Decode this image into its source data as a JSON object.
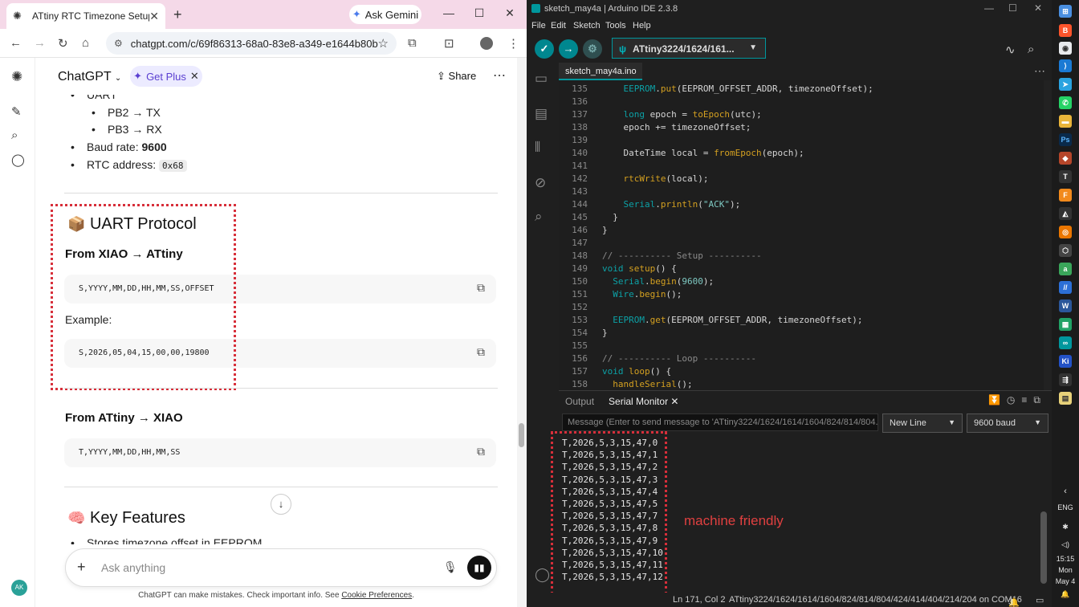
{
  "chrome": {
    "tab_title": "ATtiny RTC Timezone Setup",
    "gemini_label": "Ask Gemini",
    "url": "chatgpt.com/c/69f86313-68a0-83e8-a349-e1644b80b..."
  },
  "chatgpt": {
    "app_name": "ChatGPT",
    "get_plus": "Get Plus",
    "share": "Share",
    "avatar": "AK",
    "uart_label": "UART",
    "pb2": "PB2 → TX",
    "pb3": "PB3 → RX",
    "baud_label": "Baud rate: ",
    "baud_value": "9600",
    "rtc_label": "RTC address: ",
    "rtc_value": "0x68",
    "uart_heading": "UART Protocol",
    "uart_emoji": "📦",
    "from_xiao": "From XIAO → ATtiny",
    "code1": "S,YYYY,MM,DD,HH,MM,SS,OFFSET",
    "example_label": "Example:",
    "code2": "S,2026,05,04,15,00,00,19800",
    "from_attiny": "From ATtiny → XIAO",
    "code3": "T,YYYY,MM,DD,HH,MM,SS",
    "features_emoji": "🧠",
    "features_heading": "Key Features",
    "feature1": "Stores timezone offset in EEPROM",
    "input_placeholder": "Ask anything",
    "footer_text": "ChatGPT can make mistakes. Check important info. See ",
    "footer_link": "Cookie Preferences",
    "footer_end": "."
  },
  "ide": {
    "window_title": "sketch_may4a | Arduino IDE 2.3.8",
    "menu": [
      "File",
      "Edit",
      "Sketch",
      "Tools",
      "Help"
    ],
    "board": "ATtiny3224/1624/161...",
    "file_tab": "sketch_may4a.ino",
    "code_lines": [
      {
        "n": "135",
        "segs": [
          [
            "tx",
            "    "
          ],
          [
            "kw",
            "EEPROM"
          ],
          [
            "tx",
            "."
          ],
          [
            "fn",
            "put"
          ],
          [
            "tx",
            "(EEPROM_OFFSET_ADDR, timezoneOffset);"
          ]
        ]
      },
      {
        "n": "136",
        "segs": []
      },
      {
        "n": "137",
        "segs": [
          [
            "tx",
            "    "
          ],
          [
            "kw",
            "long"
          ],
          [
            "tx",
            " epoch = "
          ],
          [
            "fn",
            "toEpoch"
          ],
          [
            "tx",
            "(utc);"
          ]
        ]
      },
      {
        "n": "138",
        "segs": [
          [
            "tx",
            "    epoch += timezoneOffset;"
          ]
        ]
      },
      {
        "n": "139",
        "segs": []
      },
      {
        "n": "140",
        "segs": [
          [
            "tx",
            "    DateTime local = "
          ],
          [
            "fn",
            "fromEpoch"
          ],
          [
            "tx",
            "(epoch);"
          ]
        ]
      },
      {
        "n": "141",
        "segs": []
      },
      {
        "n": "142",
        "segs": [
          [
            "tx",
            "    "
          ],
          [
            "fn",
            "rtcWrite"
          ],
          [
            "tx",
            "(local);"
          ]
        ]
      },
      {
        "n": "143",
        "segs": []
      },
      {
        "n": "144",
        "segs": [
          [
            "tx",
            "    "
          ],
          [
            "kw",
            "Serial"
          ],
          [
            "tx",
            "."
          ],
          [
            "fn",
            "println"
          ],
          [
            "tx",
            "("
          ],
          [
            "str",
            "\"ACK\""
          ],
          [
            "tx",
            ");"
          ]
        ]
      },
      {
        "n": "145",
        "segs": [
          [
            "tx",
            "  }"
          ]
        ]
      },
      {
        "n": "146",
        "segs": [
          [
            "tx",
            "}"
          ]
        ]
      },
      {
        "n": "147",
        "segs": []
      },
      {
        "n": "148",
        "segs": [
          [
            "cm",
            "// ---------- Setup ----------"
          ]
        ]
      },
      {
        "n": "149",
        "segs": [
          [
            "kw",
            "void"
          ],
          [
            "tx",
            " "
          ],
          [
            "fn",
            "setup"
          ],
          [
            "tx",
            "() {"
          ]
        ]
      },
      {
        "n": "150",
        "segs": [
          [
            "tx",
            "  "
          ],
          [
            "kw",
            "Serial"
          ],
          [
            "tx",
            "."
          ],
          [
            "fn",
            "begin"
          ],
          [
            "tx",
            "("
          ],
          [
            "num",
            "9600"
          ],
          [
            "tx",
            ");"
          ]
        ]
      },
      {
        "n": "151",
        "segs": [
          [
            "tx",
            "  "
          ],
          [
            "kw",
            "Wire"
          ],
          [
            "tx",
            "."
          ],
          [
            "fn",
            "begin"
          ],
          [
            "tx",
            "();"
          ]
        ]
      },
      {
        "n": "152",
        "segs": []
      },
      {
        "n": "153",
        "segs": [
          [
            "tx",
            "  "
          ],
          [
            "kw",
            "EEPROM"
          ],
          [
            "tx",
            "."
          ],
          [
            "fn",
            "get"
          ],
          [
            "tx",
            "(EEPROM_OFFSET_ADDR, timezoneOffset);"
          ]
        ]
      },
      {
        "n": "154",
        "segs": [
          [
            "tx",
            "}"
          ]
        ]
      },
      {
        "n": "155",
        "segs": []
      },
      {
        "n": "156",
        "segs": [
          [
            "cm",
            "// ---------- Loop ----------"
          ]
        ]
      },
      {
        "n": "157",
        "segs": [
          [
            "kw",
            "void"
          ],
          [
            "tx",
            " "
          ],
          [
            "fn",
            "loop"
          ],
          [
            "tx",
            "() {"
          ]
        ]
      },
      {
        "n": "158",
        "segs": [
          [
            "tx",
            "  "
          ],
          [
            "fn",
            "handleSerial"
          ],
          [
            "tx",
            "();"
          ]
        ]
      }
    ],
    "tab_output": "Output",
    "tab_serial": "Serial Monitor",
    "msg_placeholder": "Message (Enter to send message to 'ATtiny3224/1624/1614/1604/824/814/804...",
    "line_ending": "New Line",
    "baud": "9600 baud",
    "serial_lines": [
      "T,2026,5,3,15,47,0",
      "T,2026,5,3,15,47,1",
      "T,2026,5,3,15,47,2",
      "T,2026,5,3,15,47,3",
      "T,2026,5,3,15,47,4",
      "T,2026,5,3,15,47,5",
      "T,2026,5,3,15,47,7",
      "T,2026,5,3,15,47,8",
      "T,2026,5,3,15,47,9",
      "T,2026,5,3,15,47,10",
      "T,2026,5,3,15,47,11",
      "T,2026,5,3,15,47,12"
    ],
    "annotation": "machine friendly",
    "status_pos": "Ln 171, Col 2",
    "status_board": "ATtiny3224/1624/1614/1604/824/814/804/424/414/404/214/204 on COM16",
    "status_count": "3"
  },
  "taskbar": {
    "lang": "ENG",
    "time": "15:15",
    "day": "Mon",
    "date": "May 4"
  },
  "colors": {
    "annotation_red": "#d72f3a",
    "arduino_teal": "#00979d"
  }
}
